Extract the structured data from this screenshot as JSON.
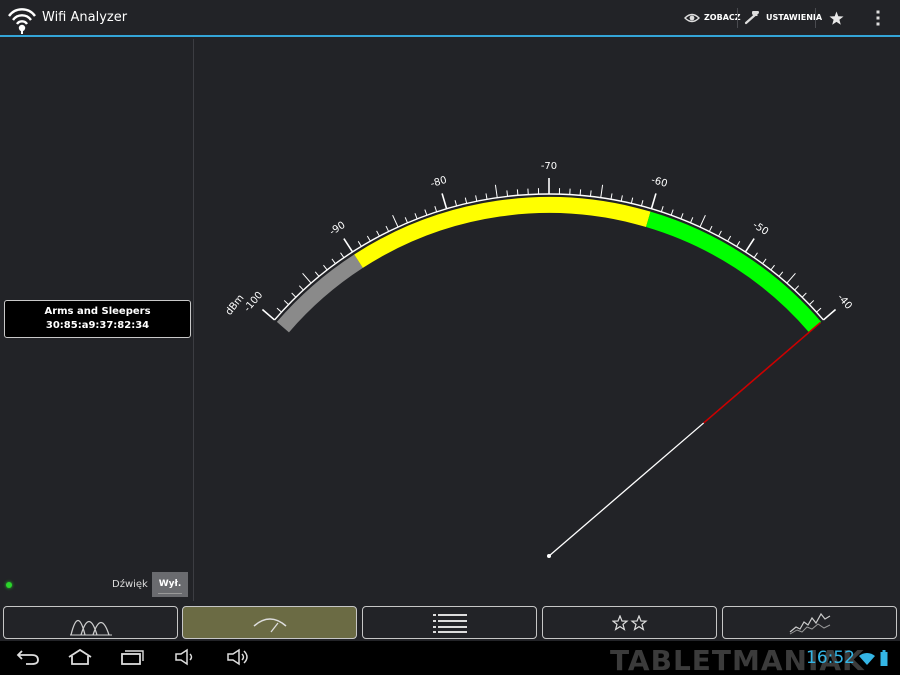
{
  "app": {
    "title": "Wifi Analyzer"
  },
  "actions": {
    "view_label": "ZOBACZ",
    "settings_label": "USTAWIENIA"
  },
  "access_point": {
    "ssid": "Arms and Sleepers",
    "bssid": "30:85:a9:37:82:34"
  },
  "sound": {
    "label": "Dźwięk",
    "toggle_value": "Wył."
  },
  "meter": {
    "unit": "dBm",
    "min": -100,
    "max": -40,
    "current_value": -40,
    "tick_labels": [
      {
        "value": -100,
        "text": "-100"
      },
      {
        "value": -90,
        "text": "-90"
      },
      {
        "value": -80,
        "text": "-80"
      },
      {
        "value": -70,
        "text": "-70"
      },
      {
        "value": -60,
        "text": "-60"
      },
      {
        "value": -50,
        "text": "-50"
      },
      {
        "value": -40,
        "text": "-40"
      }
    ],
    "zones": [
      {
        "from": -100,
        "to": -90,
        "color": "#8a8a8a"
      },
      {
        "from": -90,
        "to": -60,
        "color": "#ffff00"
      },
      {
        "from": -60,
        "to": -40,
        "color": "#00ff00"
      }
    ],
    "needle_color": "#ffffff",
    "needle_tip_color": "#cc0000"
  },
  "tabs": [
    {
      "name": "channel-graph",
      "icon": "channel-graph-icon",
      "active": false
    },
    {
      "name": "signal-meter",
      "icon": "signal-meter-icon",
      "active": true
    },
    {
      "name": "ap-list",
      "icon": "list-icon",
      "active": false
    },
    {
      "name": "channel-rating",
      "icon": "stars-icon",
      "active": false
    },
    {
      "name": "time-graph",
      "icon": "time-graph-icon",
      "active": false
    }
  ],
  "system": {
    "time": "16:52",
    "watermark": "TABLETMANIAK"
  },
  "colors": {
    "accent": "#34a5d8",
    "background": "#222327",
    "active_tab": "#6b6b44"
  }
}
